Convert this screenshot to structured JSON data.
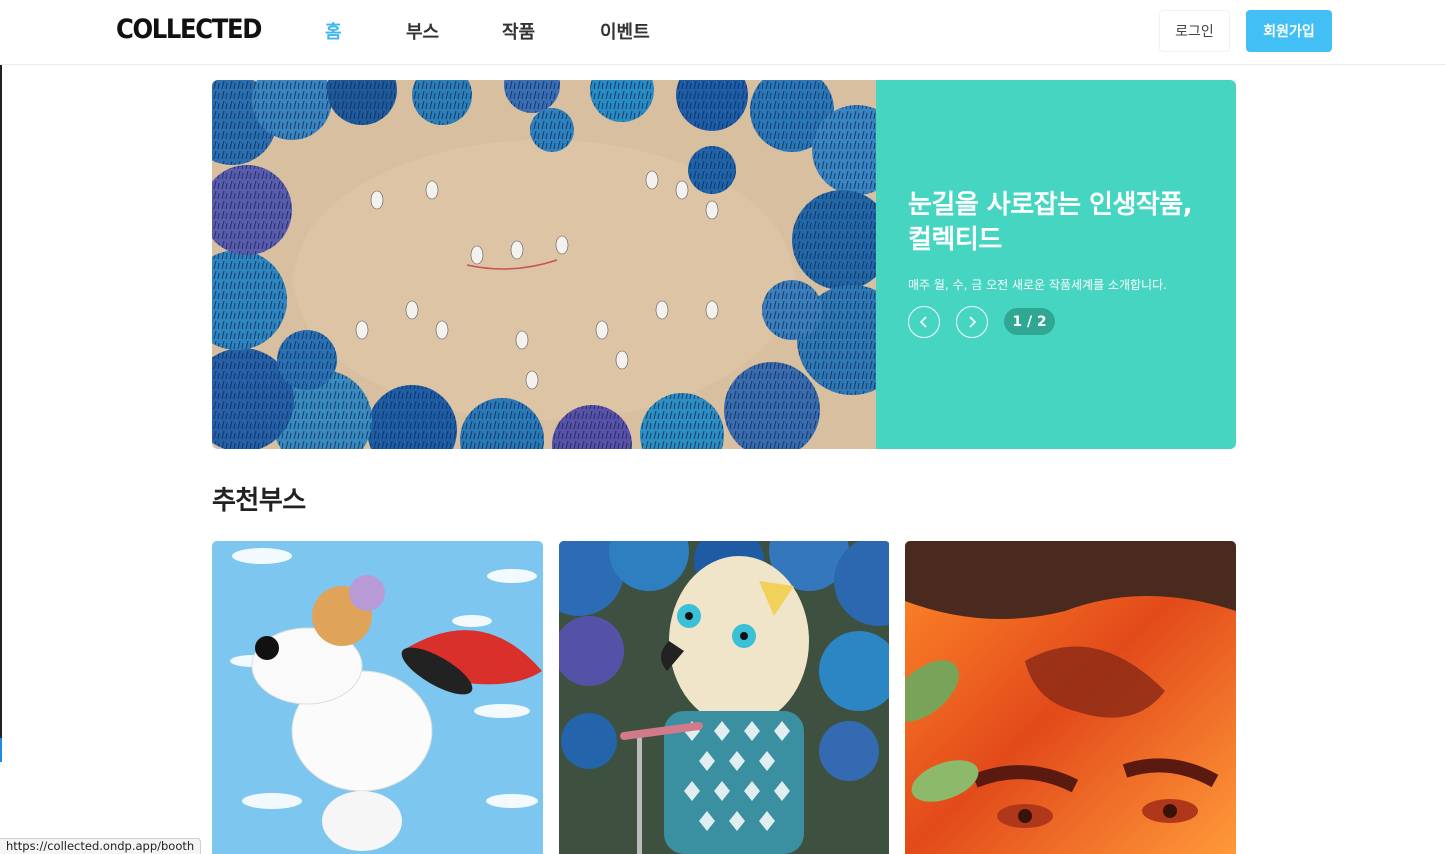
{
  "header": {
    "logo": "COLLECTED",
    "nav": [
      {
        "label": "홈",
        "active": true
      },
      {
        "label": "부스",
        "active": false
      },
      {
        "label": "작품",
        "active": false
      },
      {
        "label": "이벤트",
        "active": false
      }
    ],
    "login_label": "로그인",
    "signup_label": "회원가입"
  },
  "hero": {
    "title_line1": "눈길을 사로잡는 인생작품,",
    "title_line2": "컬렉티드",
    "subtitle": "매주 월, 수, 금 오전 새로운 작품세계를 소개합니다.",
    "counter": "1 / 2",
    "panel_color": "#45d5c1"
  },
  "section": {
    "title": "추천부스"
  },
  "colors": {
    "accent": "#3fb6ee",
    "signup": "#42bff5",
    "hero_panel": "#45d5c1"
  },
  "status_bar": {
    "url": "https://collected.ondp.app/booth"
  }
}
